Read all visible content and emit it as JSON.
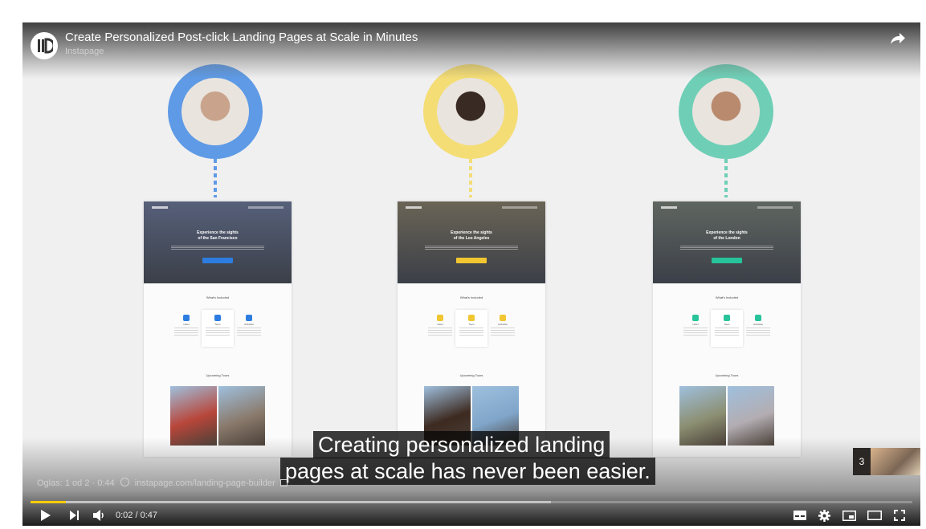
{
  "video": {
    "title": "Create Personalized Post-click Landing Pages at Scale in Minutes",
    "channel": "Instapage"
  },
  "personas": [
    {
      "name": "persona-1",
      "accent": "#5e9ae5",
      "photo_tone": "#c9a38c"
    },
    {
      "name": "persona-2",
      "accent": "#f4dd75",
      "photo_tone": "#3a2a24"
    },
    {
      "name": "persona-3",
      "accent": "#6fcfb6",
      "photo_tone": "#b98a6e"
    }
  ],
  "landing_pages": [
    {
      "hero_line1": "Experience the sights",
      "hero_line2": "of the San Francisco",
      "button_color": "#2d7de0",
      "hero_tone": "#56607a",
      "section1": "What's Included",
      "features": [
        "Hotel",
        "Tours",
        "Activities"
      ],
      "section2": "Upcoming Tours",
      "tour_tones": [
        "#b8463a",
        "#8a7a6c"
      ]
    },
    {
      "hero_line1": "Experience the sights",
      "hero_line2": "of the Los Angeles",
      "button_color": "#f1c630",
      "hero_tone": "#6a6456",
      "section1": "What's Included",
      "features": [
        "Hotel",
        "Tours",
        "Activities"
      ],
      "section2": "Upcoming Tours",
      "tour_tones": [
        "#3d2a20",
        "#7fa5c9"
      ]
    },
    {
      "hero_line1": "Experience the sights",
      "hero_line2": "of the London",
      "button_color": "#27c39a",
      "hero_tone": "#5f6660",
      "section1": "What's Included",
      "features": [
        "Hotel",
        "Tours",
        "Activities"
      ],
      "section2": "Upcoming Tours",
      "tour_tones": [
        "#8c8f72",
        "#b3adb2"
      ]
    }
  ],
  "captions": {
    "line1": "Creating personalized landing",
    "line2": "pages at scale has never been easier."
  },
  "ad": {
    "label": "Oglas: 1 od 2 · 0:44",
    "url": "instapage.com/landing-page-builder"
  },
  "endscreen": {
    "count": "3"
  },
  "playback": {
    "time": "0:02 / 0:47",
    "played_fraction": 0.04,
    "loaded_fraction": 0.59
  },
  "colors": {
    "progress": "#ffcc00"
  }
}
